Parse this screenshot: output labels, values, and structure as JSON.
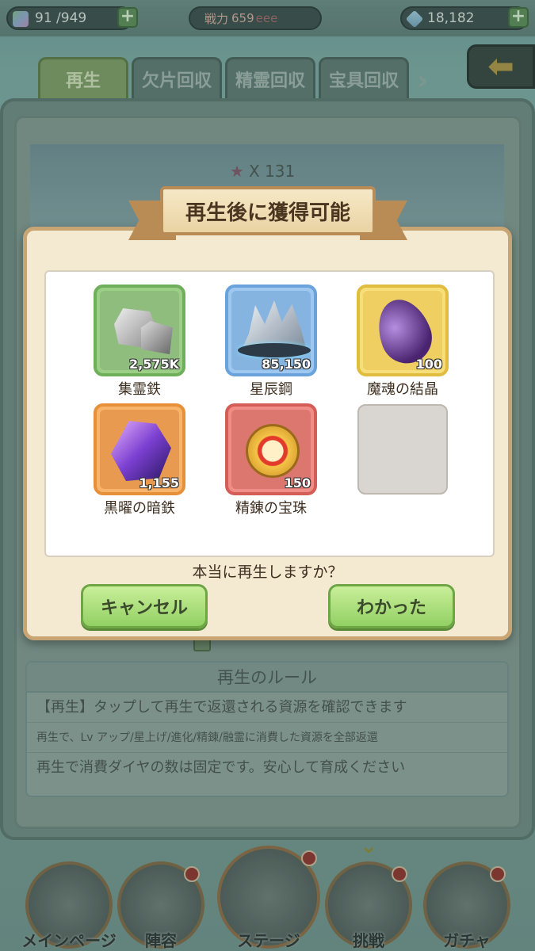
{
  "topbar": {
    "stamina": "91 /949",
    "power_label": "戦力",
    "power_value": "659",
    "power_suffix": "eee",
    "gems": "18,182",
    "plus": "+"
  },
  "tabs": [
    {
      "label": "再生",
      "active": true
    },
    {
      "label": "欠片回収"
    },
    {
      "label": "精霊回収"
    },
    {
      "label": "宝具回収"
    }
  ],
  "tab_arrow": "›",
  "back_arrow": "⬅",
  "hero": {
    "star_count": "X 131",
    "star_glyph": "★"
  },
  "modal": {
    "title": "再生後に獲得可能",
    "rewards": [
      {
        "name": "集霊鉄",
        "qty": "2,575K",
        "frame": "green",
        "icon": "ore-rocks-icon"
      },
      {
        "name": "星辰鋼",
        "qty": "85,150",
        "frame": "blue",
        "icon": "crystal-ore-icon"
      },
      {
        "name": "魔魂の結晶",
        "qty": "100",
        "frame": "yellow",
        "icon": "soul-crystal-icon"
      },
      {
        "name": "黒曜の暗鉄",
        "qty": "1,155",
        "frame": "orange",
        "icon": "obsidian-gem-icon"
      },
      {
        "name": "精錬の宝珠",
        "qty": "150",
        "frame": "red",
        "icon": "refining-orb-icon"
      }
    ],
    "confirm_text": "本当に再生しますか？",
    "cancel_label": "キャンセル",
    "ok_label": "わかった"
  },
  "rules": {
    "title": "再生のルール",
    "lines": [
      "【再生】タップして再生で返還される資源を確認できます",
      "再生で、Lv アップ/星上げ/進化/精錬/融霊に消費した資源を全部返還",
      "再生で消費ダイヤの数は固定です。安心して育成ください"
    ]
  },
  "bottom_nav": [
    {
      "label": "メインページ",
      "badge": false
    },
    {
      "label": "陣容",
      "badge": true
    },
    {
      "label": "ステージ",
      "badge": true
    },
    {
      "label": "挑戦",
      "badge": true
    },
    {
      "label": "ガチャ",
      "badge": true
    }
  ],
  "colors": {
    "modal_bg": "#f4ead2",
    "modal_border": "#c9a573",
    "button_green": "#92d063"
  }
}
